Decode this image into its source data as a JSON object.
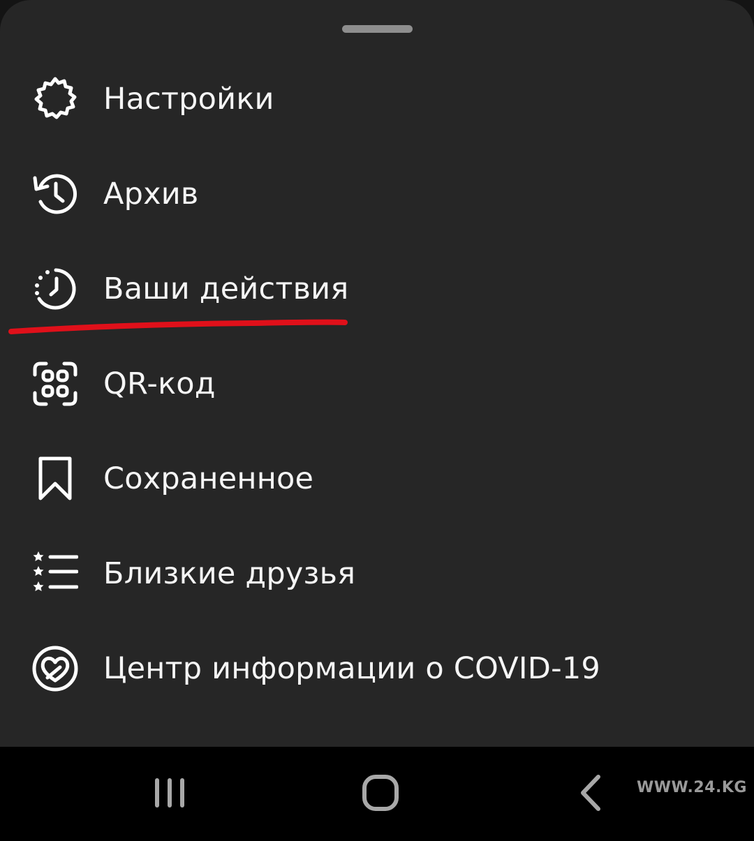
{
  "menu": {
    "items": [
      {
        "label": "Настройки",
        "icon": "gear-icon"
      },
      {
        "label": "Архив",
        "icon": "archive-history-icon"
      },
      {
        "label": "Ваши действия",
        "icon": "your-activity-icon",
        "highlighted": true
      },
      {
        "label": "QR-код",
        "icon": "qr-code-icon"
      },
      {
        "label": "Сохраненное",
        "icon": "bookmark-icon"
      },
      {
        "label": "Близкие друзья",
        "icon": "close-friends-icon"
      },
      {
        "label": "Центр информации о COVID-19",
        "icon": "covid-info-heart-icon"
      }
    ]
  },
  "annotation": {
    "color": "#e0101a"
  },
  "navbar": {
    "buttons": [
      {
        "icon": "recent-apps-icon"
      },
      {
        "icon": "home-icon"
      },
      {
        "icon": "back-icon"
      }
    ]
  },
  "watermark": {
    "text": "WWW.24.KG"
  },
  "colors": {
    "sheet": "#262626",
    "text": "#f5f5f5",
    "navbar": "#000000"
  }
}
